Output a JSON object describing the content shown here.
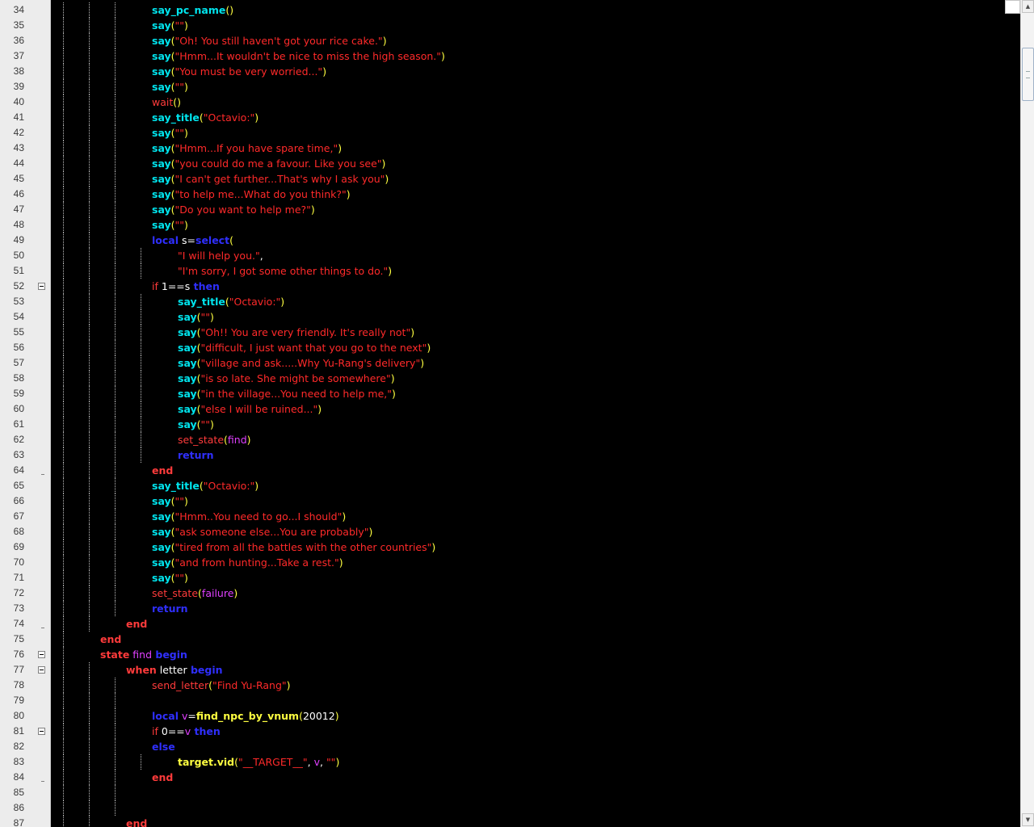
{
  "editor": {
    "first_line": 34,
    "lines": [
      {
        "n": "34",
        "fold": null,
        "indent": 3,
        "tokens": [
          [
            "say_pc_name",
            "fn"
          ],
          [
            "(",
            "par"
          ],
          [
            ")",
            "par"
          ]
        ]
      },
      {
        "n": "35",
        "fold": null,
        "indent": 3,
        "tokens": [
          [
            "say",
            "fn"
          ],
          [
            "(",
            "par"
          ],
          [
            "\"\"",
            "str"
          ],
          [
            ")",
            "par"
          ]
        ]
      },
      {
        "n": "36",
        "fold": null,
        "indent": 3,
        "tokens": [
          [
            "say",
            "fn"
          ],
          [
            "(",
            "par"
          ],
          [
            "\"Oh! You still haven't got your rice cake.\"",
            "str"
          ],
          [
            ")",
            "par"
          ]
        ]
      },
      {
        "n": "37",
        "fold": null,
        "indent": 3,
        "tokens": [
          [
            "say",
            "fn"
          ],
          [
            "(",
            "par"
          ],
          [
            "\"Hmm...It wouldn't be nice to miss the high season.\"",
            "str"
          ],
          [
            ")",
            "par"
          ]
        ]
      },
      {
        "n": "38",
        "fold": null,
        "indent": 3,
        "tokens": [
          [
            "say",
            "fn"
          ],
          [
            "(",
            "par"
          ],
          [
            "\"You must be very worried...\"",
            "str"
          ],
          [
            ")",
            "par"
          ]
        ]
      },
      {
        "n": "39",
        "fold": null,
        "indent": 3,
        "tokens": [
          [
            "say",
            "fn"
          ],
          [
            "(",
            "par"
          ],
          [
            "\"\"",
            "str"
          ],
          [
            ")",
            "par"
          ]
        ]
      },
      {
        "n": "40",
        "fold": null,
        "indent": 3,
        "tokens": [
          [
            "wait",
            "fnp"
          ],
          [
            "(",
            "par"
          ],
          [
            ")",
            "par"
          ]
        ]
      },
      {
        "n": "41",
        "fold": null,
        "indent": 3,
        "tokens": [
          [
            "say_title",
            "fn"
          ],
          [
            "(",
            "par"
          ],
          [
            "\"Octavio:\"",
            "str"
          ],
          [
            ")",
            "par"
          ]
        ]
      },
      {
        "n": "42",
        "fold": null,
        "indent": 3,
        "tokens": [
          [
            "say",
            "fn"
          ],
          [
            "(",
            "par"
          ],
          [
            "\"\"",
            "str"
          ],
          [
            ")",
            "par"
          ]
        ]
      },
      {
        "n": "43",
        "fold": null,
        "indent": 3,
        "tokens": [
          [
            "say",
            "fn"
          ],
          [
            "(",
            "par"
          ],
          [
            "\"Hmm...If you have spare time,\"",
            "str"
          ],
          [
            ")",
            "par"
          ]
        ]
      },
      {
        "n": "44",
        "fold": null,
        "indent": 3,
        "tokens": [
          [
            "say",
            "fn"
          ],
          [
            "(",
            "par"
          ],
          [
            "\"you could do me a favour. Like you see\"",
            "str"
          ],
          [
            ")",
            "par"
          ]
        ]
      },
      {
        "n": "45",
        "fold": null,
        "indent": 3,
        "tokens": [
          [
            "say",
            "fn"
          ],
          [
            "(",
            "par"
          ],
          [
            "\"I can't get further...That's why I ask you\"",
            "str"
          ],
          [
            ")",
            "par"
          ]
        ]
      },
      {
        "n": "46",
        "fold": null,
        "indent": 3,
        "tokens": [
          [
            "say",
            "fn"
          ],
          [
            "(",
            "par"
          ],
          [
            "\"to help me...What do you think?\"",
            "str"
          ],
          [
            ")",
            "par"
          ]
        ]
      },
      {
        "n": "47",
        "fold": null,
        "indent": 3,
        "tokens": [
          [
            "say",
            "fn"
          ],
          [
            "(",
            "par"
          ],
          [
            "\"Do you want to help me?\"",
            "str"
          ],
          [
            ")",
            "par"
          ]
        ]
      },
      {
        "n": "48",
        "fold": null,
        "indent": 3,
        "tokens": [
          [
            "say",
            "fn"
          ],
          [
            "(",
            "par"
          ],
          [
            "\"\"",
            "str"
          ],
          [
            ")",
            "par"
          ]
        ]
      },
      {
        "n": "49",
        "fold": null,
        "indent": 3,
        "tokens": [
          [
            "local",
            "kw"
          ],
          [
            " s",
            "id"
          ],
          [
            "=",
            "id"
          ],
          [
            "select",
            "kw"
          ],
          [
            "(",
            "par"
          ]
        ]
      },
      {
        "n": "50",
        "fold": null,
        "indent": 4,
        "tokens": [
          [
            "\"I will help you.\"",
            "str"
          ],
          [
            ",",
            "id"
          ]
        ]
      },
      {
        "n": "51",
        "fold": null,
        "indent": 4,
        "tokens": [
          [
            "\"I'm sorry, I got some other things to do.\"",
            "str"
          ],
          [
            ")",
            "par"
          ]
        ]
      },
      {
        "n": "52",
        "fold": "open",
        "indent": 3,
        "tokens": [
          [
            "if",
            "fnp"
          ],
          [
            " 1",
            "num"
          ],
          [
            "==",
            "id"
          ],
          [
            "s",
            "id"
          ],
          [
            " then",
            "kw"
          ]
        ]
      },
      {
        "n": "53",
        "fold": null,
        "indent": 4,
        "tokens": [
          [
            "say_title",
            "fn"
          ],
          [
            "(",
            "par"
          ],
          [
            "\"Octavio:\"",
            "str"
          ],
          [
            ")",
            "par"
          ]
        ]
      },
      {
        "n": "54",
        "fold": null,
        "indent": 4,
        "tokens": [
          [
            "say",
            "fn"
          ],
          [
            "(",
            "par"
          ],
          [
            "\"\"",
            "str"
          ],
          [
            ")",
            "par"
          ]
        ]
      },
      {
        "n": "55",
        "fold": null,
        "indent": 4,
        "tokens": [
          [
            "say",
            "fn"
          ],
          [
            "(",
            "par"
          ],
          [
            "\"Oh!! You are very friendly. It's really not\"",
            "str"
          ],
          [
            ")",
            "par"
          ]
        ]
      },
      {
        "n": "56",
        "fold": null,
        "indent": 4,
        "tokens": [
          [
            "say",
            "fn"
          ],
          [
            "(",
            "par"
          ],
          [
            "\"difficult, I just want that you go to the next\"",
            "str"
          ],
          [
            ")",
            "par"
          ]
        ]
      },
      {
        "n": "57",
        "fold": null,
        "indent": 4,
        "tokens": [
          [
            "say",
            "fn"
          ],
          [
            "(",
            "par"
          ],
          [
            "\"village and ask.....Why Yu-Rang's delivery\"",
            "str"
          ],
          [
            ")",
            "par"
          ]
        ]
      },
      {
        "n": "58",
        "fold": null,
        "indent": 4,
        "tokens": [
          [
            "say",
            "fn"
          ],
          [
            "(",
            "par"
          ],
          [
            "\"is so late. She might be somewhere\"",
            "str"
          ],
          [
            ")",
            "par"
          ]
        ]
      },
      {
        "n": "59",
        "fold": null,
        "indent": 4,
        "tokens": [
          [
            "say",
            "fn"
          ],
          [
            "(",
            "par"
          ],
          [
            "\"in the village...You need to help me,\"",
            "str"
          ],
          [
            ")",
            "par"
          ]
        ]
      },
      {
        "n": "60",
        "fold": null,
        "indent": 4,
        "tokens": [
          [
            "say",
            "fn"
          ],
          [
            "(",
            "par"
          ],
          [
            "\"else I will be ruined...\"",
            "str"
          ],
          [
            ")",
            "par"
          ]
        ]
      },
      {
        "n": "61",
        "fold": null,
        "indent": 4,
        "tokens": [
          [
            "say",
            "fn"
          ],
          [
            "(",
            "par"
          ],
          [
            "\"\"",
            "str"
          ],
          [
            ")",
            "par"
          ]
        ]
      },
      {
        "n": "62",
        "fold": null,
        "indent": 4,
        "tokens": [
          [
            "set_state",
            "fnp"
          ],
          [
            "(",
            "par"
          ],
          [
            "find",
            "arg"
          ],
          [
            ")",
            "par"
          ]
        ]
      },
      {
        "n": "63",
        "fold": null,
        "indent": 4,
        "tokens": [
          [
            "return",
            "kw"
          ]
        ]
      },
      {
        "n": "64",
        "fold": "end",
        "indent": 3,
        "tokens": [
          [
            "end",
            "red"
          ]
        ]
      },
      {
        "n": "65",
        "fold": null,
        "indent": 3,
        "tokens": [
          [
            "say_title",
            "fn"
          ],
          [
            "(",
            "par"
          ],
          [
            "\"Octavio:\"",
            "str"
          ],
          [
            ")",
            "par"
          ]
        ]
      },
      {
        "n": "66",
        "fold": null,
        "indent": 3,
        "tokens": [
          [
            "say",
            "fn"
          ],
          [
            "(",
            "par"
          ],
          [
            "\"\"",
            "str"
          ],
          [
            ")",
            "par"
          ]
        ]
      },
      {
        "n": "67",
        "fold": null,
        "indent": 3,
        "tokens": [
          [
            "say",
            "fn"
          ],
          [
            "(",
            "par"
          ],
          [
            "\"Hmm..You need to go...I should\"",
            "str"
          ],
          [
            ")",
            "par"
          ]
        ]
      },
      {
        "n": "68",
        "fold": null,
        "indent": 3,
        "tokens": [
          [
            "say",
            "fn"
          ],
          [
            "(",
            "par"
          ],
          [
            "\"ask someone else...You are probably\"",
            "str"
          ],
          [
            ")",
            "par"
          ]
        ]
      },
      {
        "n": "69",
        "fold": null,
        "indent": 3,
        "tokens": [
          [
            "say",
            "fn"
          ],
          [
            "(",
            "par"
          ],
          [
            "\"tired from all the battles with the other countries\"",
            "str"
          ],
          [
            ")",
            "par"
          ]
        ]
      },
      {
        "n": "70",
        "fold": null,
        "indent": 3,
        "tokens": [
          [
            "say",
            "fn"
          ],
          [
            "(",
            "par"
          ],
          [
            "\"and from hunting...Take a rest.\"",
            "str"
          ],
          [
            ")",
            "par"
          ]
        ]
      },
      {
        "n": "71",
        "fold": null,
        "indent": 3,
        "tokens": [
          [
            "say",
            "fn"
          ],
          [
            "(",
            "par"
          ],
          [
            "\"\"",
            "str"
          ],
          [
            ")",
            "par"
          ]
        ]
      },
      {
        "n": "72",
        "fold": null,
        "indent": 3,
        "tokens": [
          [
            "set_state",
            "fnp"
          ],
          [
            "(",
            "par"
          ],
          [
            "failure",
            "arg"
          ],
          [
            ")",
            "par"
          ]
        ]
      },
      {
        "n": "73",
        "fold": null,
        "indent": 3,
        "tokens": [
          [
            "return",
            "kw"
          ]
        ]
      },
      {
        "n": "74",
        "fold": "end",
        "indent": 2,
        "tokens": [
          [
            "end",
            "red"
          ]
        ]
      },
      {
        "n": "75",
        "fold": null,
        "indent": 1,
        "tokens": [
          [
            "end",
            "red"
          ]
        ]
      },
      {
        "n": "76",
        "fold": "open",
        "indent": 1,
        "tokens": [
          [
            "state",
            "red"
          ],
          [
            " find",
            "arg"
          ],
          [
            " begin",
            "kw"
          ]
        ]
      },
      {
        "n": "77",
        "fold": "open",
        "indent": 2,
        "tokens": [
          [
            "when",
            "red"
          ],
          [
            " letter",
            "id"
          ],
          [
            " begin",
            "kw"
          ]
        ]
      },
      {
        "n": "78",
        "fold": null,
        "indent": 3,
        "tokens": [
          [
            "send_letter",
            "fnp"
          ],
          [
            "(",
            "par"
          ],
          [
            "\"Find Yu-Rang\"",
            "str"
          ],
          [
            ")",
            "par"
          ]
        ]
      },
      {
        "n": "79",
        "fold": null,
        "indent": 3,
        "tokens": []
      },
      {
        "n": "80",
        "fold": null,
        "indent": 3,
        "tokens": [
          [
            "local",
            "kw"
          ],
          [
            " v",
            "arg"
          ],
          [
            "=",
            "id"
          ],
          [
            "find_npc_by_vnum",
            "ylw"
          ],
          [
            "(",
            "par"
          ],
          [
            "20012",
            "num"
          ],
          [
            ")",
            "par"
          ]
        ]
      },
      {
        "n": "81",
        "fold": "open",
        "indent": 3,
        "tokens": [
          [
            "if",
            "fnp"
          ],
          [
            " 0",
            "num"
          ],
          [
            "==",
            "id"
          ],
          [
            "v",
            "arg"
          ],
          [
            " then",
            "kw"
          ]
        ]
      },
      {
        "n": "82",
        "fold": null,
        "indent": 3,
        "tokens": [
          [
            "else",
            "kw"
          ]
        ]
      },
      {
        "n": "83",
        "fold": null,
        "indent": 4,
        "tokens": [
          [
            "target.vid",
            "ylw"
          ],
          [
            "(",
            "par"
          ],
          [
            "\"__TARGET__\"",
            "str"
          ],
          [
            ", ",
            "id"
          ],
          [
            "v",
            "arg"
          ],
          [
            ", ",
            "id"
          ],
          [
            "\"\"",
            "str"
          ],
          [
            ")",
            "par"
          ]
        ]
      },
      {
        "n": "84",
        "fold": "end",
        "indent": 3,
        "tokens": [
          [
            "end",
            "red"
          ]
        ]
      },
      {
        "n": "85",
        "fold": null,
        "indent": 3,
        "tokens": []
      },
      {
        "n": "86",
        "fold": null,
        "indent": 3,
        "tokens": []
      },
      {
        "n": "87",
        "fold": null,
        "indent": 2,
        "tokens": [
          [
            "end",
            "red"
          ]
        ]
      }
    ]
  },
  "scrollbar": {
    "up_arrow": "▲",
    "down_arrow": "▼",
    "position_fraction": 0.06
  },
  "colors": {
    "background": "#000000",
    "keyword": "#2f2fff",
    "block_keyword": "#ff3b3b",
    "function": "#00e5ee",
    "string": "#ff2a2a",
    "paren": "#ffff40",
    "argument": "#e040ff"
  },
  "icons": {
    "fold_open": "fold-minus-icon",
    "fold_end": "fold-end-icon"
  }
}
